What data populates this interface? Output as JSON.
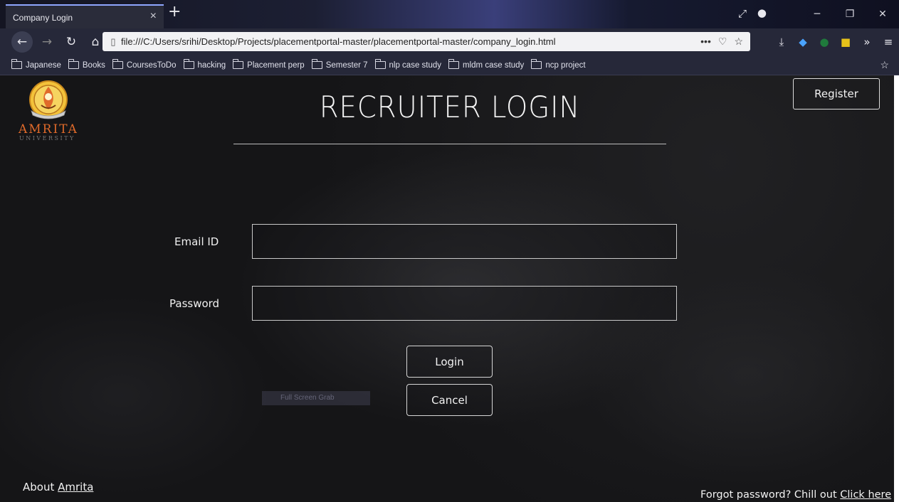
{
  "browser": {
    "tab_title": "Company Login",
    "tab_close_icon": "×",
    "new_tab_icon": "+",
    "url": "file:///C:/Users/srihi/Desktop/Projects/placementportal-master/placementportal-master/company_login.html",
    "url_actions": [
      "•••",
      "♡",
      "☆"
    ],
    "bookmarks": [
      "Japanese",
      "Books",
      "CoursesToDo",
      "hacking",
      "Placement perp",
      "Semester 7",
      "nlp case study",
      "mldm case study",
      "ncp project"
    ]
  },
  "page": {
    "logo_text": "AMRITA",
    "logo_subtext": "UNIVERSITY",
    "title": "RECRUITER LOGIN",
    "register_label": "Register",
    "email_label": "Email ID",
    "email_value": "",
    "password_label": "Password",
    "password_value": "",
    "login_label": "Login",
    "cancel_label": "Cancel",
    "ghost_badge_text": "Full Screen Grab",
    "about_prefix": "About ",
    "about_link": "Amrita",
    "forgot_prefix": "Forgot password? Chill out ",
    "forgot_link": "Click here"
  },
  "colors": {
    "background": "#151517",
    "text": "#f2f2f2",
    "logo_orange": "#e06a2a",
    "tab_accent": "#8fa6ff"
  }
}
